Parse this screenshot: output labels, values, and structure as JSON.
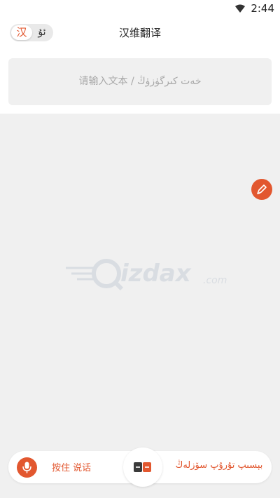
{
  "status_bar": {
    "time": "2:44",
    "wifi_icon": "wifi-icon"
  },
  "header": {
    "title": "汉维翻译",
    "lang_toggle": {
      "left": "汉",
      "right": "ئۇ",
      "active": "left"
    }
  },
  "input": {
    "placeholder": "请输入文本 / خەت كىرگۈزۈڭ"
  },
  "watermark": {
    "brand": "izdax",
    "domain": ".com"
  },
  "fab": {
    "icon": "pen-icon"
  },
  "bottom_bar": {
    "mic_icon": "microphone-icon",
    "hold_to_speak_chinese": "按住 说话",
    "swap_icon": "swap-language-icon",
    "hold_to_speak_uyghur": "بېسىپ تۇرۇپ سۆزلەڭ"
  },
  "colors": {
    "accent": "#e2572f",
    "background": "#f0f0f0",
    "surface": "#ffffff"
  }
}
